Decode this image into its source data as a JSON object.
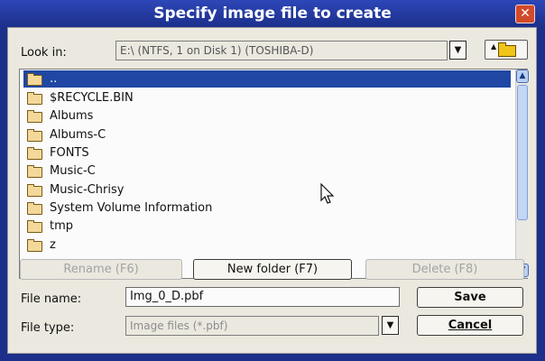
{
  "window": {
    "title": "Specify image file to create",
    "close_symbol": "✕"
  },
  "look_in": {
    "label": "Look in:",
    "value": "E:\\  (NTFS, 1 on Disk 1) (TOSHIBA-D)",
    "dropdown_symbol": "▼",
    "up_icon": "folder-up-icon"
  },
  "file_list": {
    "items": [
      {
        "name": "..",
        "icon": "folder-icon",
        "selected": true
      },
      {
        "name": "$RECYCLE.BIN",
        "icon": "folder-icon"
      },
      {
        "name": "Albums",
        "icon": "folder-icon"
      },
      {
        "name": "Albums-C",
        "icon": "folder-icon"
      },
      {
        "name": "FONTS",
        "icon": "folder-icon"
      },
      {
        "name": "Music-C",
        "icon": "folder-icon"
      },
      {
        "name": "Music-Chrisy",
        "icon": "folder-icon"
      },
      {
        "name": "System Volume Information",
        "icon": "folder-icon"
      },
      {
        "name": "tmp",
        "icon": "folder-icon"
      },
      {
        "name": "z",
        "icon": "folder-icon"
      }
    ],
    "scroll_up_symbol": "▲",
    "scroll_down_symbol": "▼"
  },
  "actions": {
    "rename_label": "Rename (F6)",
    "new_folder_label": "New folder (F7)",
    "delete_label": "Delete (F8)"
  },
  "file_name": {
    "label": "File name:",
    "value": "Img_0_D.pbf"
  },
  "file_type": {
    "label": "File type:",
    "value": "Image files (*.pbf)",
    "dropdown_symbol": "▼"
  },
  "buttons": {
    "save_label": "Save",
    "cancel_label": "Cancel"
  },
  "colors": {
    "title_bar": "#1c2f8a",
    "selection": "#1f47a3",
    "panel": "#ebe8df"
  }
}
